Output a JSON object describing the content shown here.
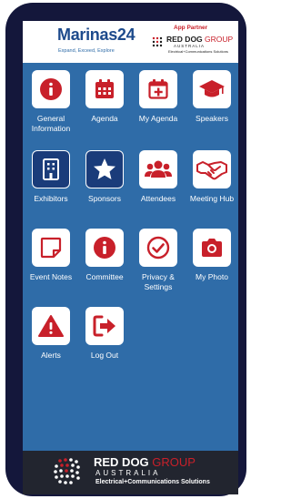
{
  "header": {
    "brand": "Marinas24",
    "tagline": "Expand, Exceed, Explore",
    "partner_label": "App Partner",
    "partner_name": "RED DOG",
    "partner_group": "GROUP",
    "partner_country": "AUSTRALIA",
    "partner_tagline": "Electrical+Communications Solutions"
  },
  "tiles": [
    {
      "label": "General Information",
      "icon": "info-icon"
    },
    {
      "label": "Agenda",
      "icon": "calendar-icon"
    },
    {
      "label": "My Agenda",
      "icon": "calendar-plus-icon"
    },
    {
      "label": "Speakers",
      "icon": "graduation-cap-icon"
    },
    {
      "label": "Exhibitors",
      "icon": "building-icon"
    },
    {
      "label": "Sponsors",
      "icon": "star-icon"
    },
    {
      "label": "Attendees",
      "icon": "users-icon"
    },
    {
      "label": "Meeting Hub",
      "icon": "handshake-icon"
    },
    {
      "label": "Event Notes",
      "icon": "note-icon"
    },
    {
      "label": "Committee",
      "icon": "info-icon"
    },
    {
      "label": "Privacy & Settings",
      "icon": "check-circle-icon"
    },
    {
      "label": "My Photo",
      "icon": "camera-icon"
    },
    {
      "label": "Alerts",
      "icon": "alert-icon"
    },
    {
      "label": "Log Out",
      "icon": "logout-icon"
    }
  ],
  "footer": {
    "name": "RED DOG",
    "group": "GROUP",
    "country": "AUSTRALIA",
    "tagline": "Electrical+Communications Solutions"
  },
  "colors": {
    "screen_bg": "#2f6ca8",
    "icon_red": "#c8202a",
    "dark_tile": "#1a3c7a",
    "frame": "#14173b"
  }
}
